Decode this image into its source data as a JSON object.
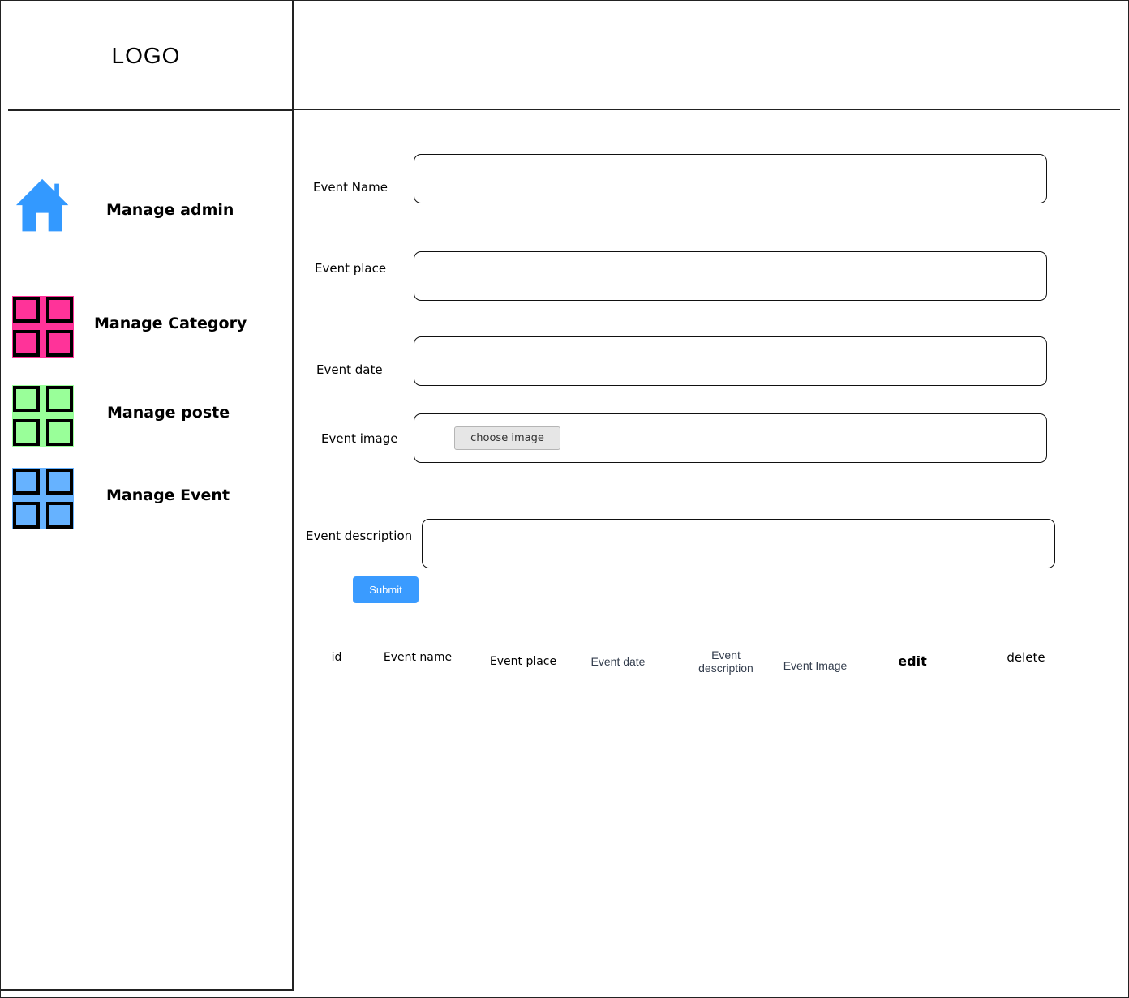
{
  "header": {
    "logo_text": "LOGO"
  },
  "sidebar": {
    "items": [
      {
        "label": "Manage admin",
        "icon": "home-icon",
        "color": "#3399ff"
      },
      {
        "label": "Manage Category",
        "icon": "grid-icon",
        "color": "#ff3399"
      },
      {
        "label": "Manage poste",
        "icon": "grid-icon",
        "color": "#99ff99"
      },
      {
        "label": "Manage Event",
        "icon": "grid-icon",
        "color": "#66b2ff"
      }
    ]
  },
  "form": {
    "event_name_label": "Event Name",
    "event_name_value": "",
    "event_place_label": "Event place",
    "event_place_value": "",
    "event_date_label": "Event date",
    "event_date_value": "",
    "event_image_label": "Event image",
    "choose_image_label": "choose image",
    "event_description_label": "Event description",
    "event_description_value": "",
    "submit_label": "Submit",
    "submit_color": "#3a9bff"
  },
  "table": {
    "columns": [
      "id",
      "Event name",
      "Event place",
      "Event date",
      "Event description",
      "Event Image",
      "edit",
      "delete"
    ]
  }
}
